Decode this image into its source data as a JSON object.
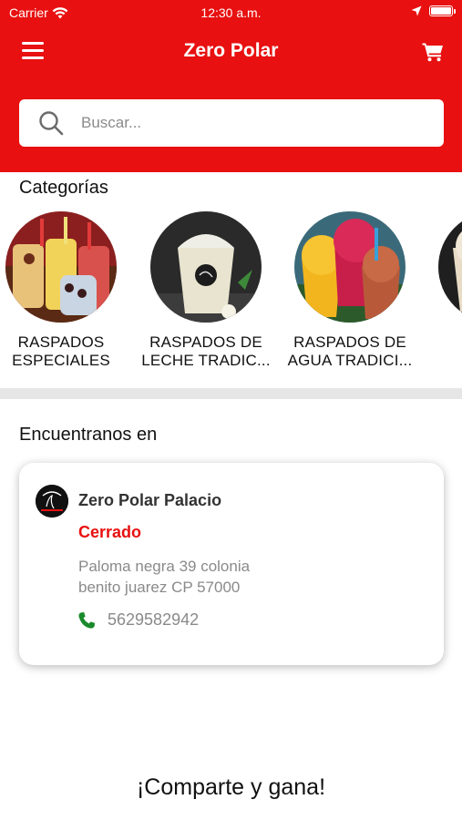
{
  "status_bar": {
    "carrier": "Carrier",
    "time": "12:30 a.m."
  },
  "header": {
    "title": "Zero Polar"
  },
  "search": {
    "placeholder": "Buscar..."
  },
  "categories": {
    "title": "Categorías",
    "items": [
      {
        "label_line1": "RASPADOS",
        "label_line2": "ESPECIALES"
      },
      {
        "label_line1": "RASPADOS DE",
        "label_line2": "LECHE TRADIC..."
      },
      {
        "label_line1": "RASPADOS DE",
        "label_line2": "AGUA TRADICI..."
      },
      {
        "label_line1": "I",
        "label_line2": ""
      }
    ]
  },
  "locations": {
    "title": "Encuentranos en",
    "store": {
      "name": "Zero Polar Palacio",
      "status": "Cerrado",
      "address_line1": "Paloma negra 39 colonia",
      "address_line2": "benito juarez CP 57000",
      "phone": "5629582942"
    }
  },
  "share": {
    "text": "¡Comparte y gana!"
  },
  "colors": {
    "brand_red": "#e81010",
    "closed_red": "#e81010",
    "phone_green": "#1a8a2c"
  },
  "icons": [
    "wifi-icon",
    "location-arrow-icon",
    "battery-icon",
    "menu-icon",
    "cart-icon",
    "search-icon",
    "phone-icon"
  ]
}
